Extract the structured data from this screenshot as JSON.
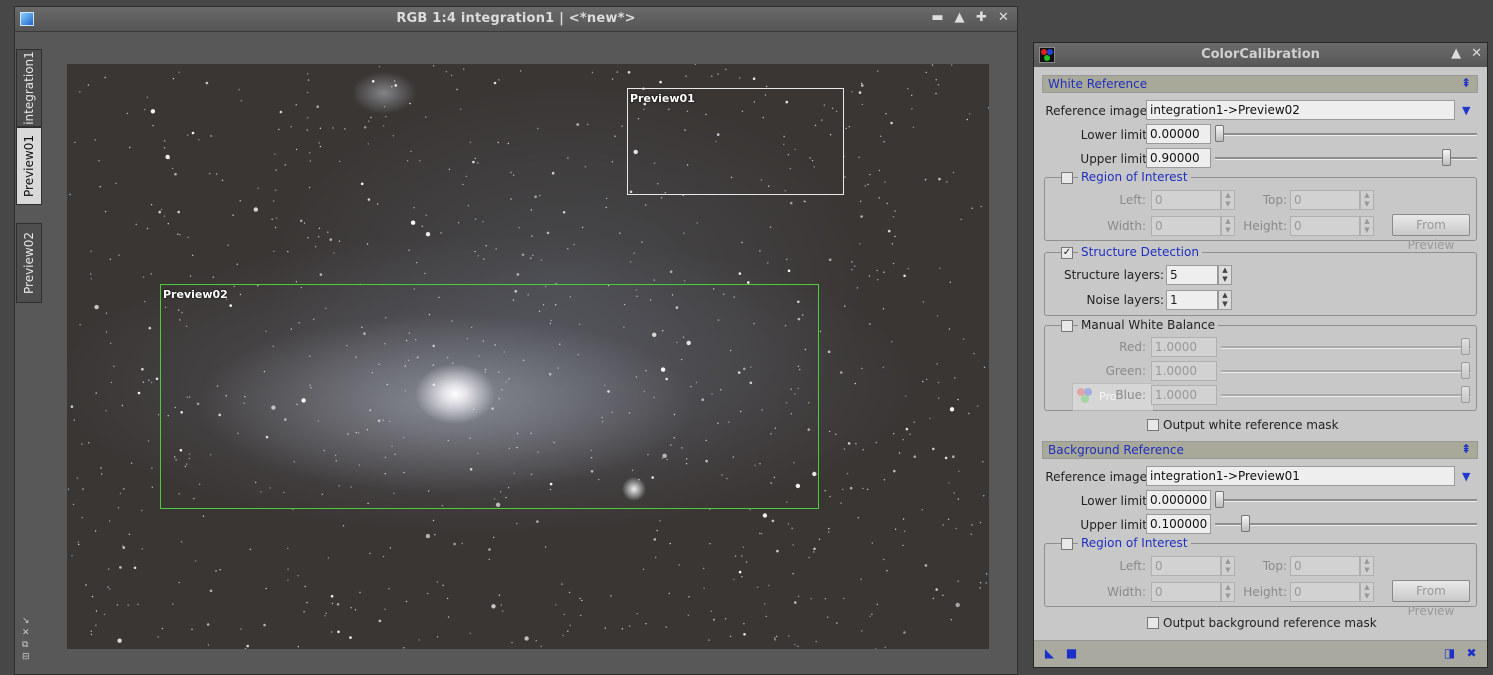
{
  "image_window": {
    "title": "RGB 1:4 integration1 | <*new*>",
    "controls": [
      "▬",
      "▲",
      "✚",
      "✕"
    ],
    "tabs": [
      "integration1",
      "Preview01",
      "Preview02"
    ],
    "active_tab": "Preview01",
    "previews": [
      {
        "label": "Preview01",
        "color": "#e8e8e8"
      },
      {
        "label": "Preview02",
        "color": "#4ecb3c"
      }
    ],
    "side_icons": [
      "↘",
      "✕",
      "⧉",
      "⊟"
    ]
  },
  "dialog": {
    "title": "ColorCalibration",
    "controls": [
      "▲",
      "✕"
    ],
    "white_reference": {
      "header": "White Reference",
      "reference_image_label": "Reference image:",
      "reference_image_value": "integration1->Preview02",
      "lower_limit_label": "Lower limit:",
      "lower_limit_value": "0.00000",
      "lower_limit_fraction": 0.0,
      "upper_limit_label": "Upper limit:",
      "upper_limit_value": "0.90000",
      "upper_limit_fraction": 0.9,
      "roi": {
        "title": "Region of Interest",
        "checked": false,
        "left_label": "Left:",
        "left_value": "0",
        "top_label": "Top:",
        "top_value": "0",
        "width_label": "Width:",
        "width_value": "0",
        "height_label": "Height:",
        "height_value": "0",
        "from_preview": "From Preview"
      },
      "structure": {
        "title": "Structure Detection",
        "checked": true,
        "layers_label": "Structure layers:",
        "layers_value": "5",
        "noise_label": "Noise layers:",
        "noise_value": "1"
      },
      "manual": {
        "title": "Manual White Balance",
        "checked": false,
        "red_label": "Red:",
        "red_value": "1.0000",
        "green_label": "Green:",
        "green_value": "1.0000",
        "blue_label": "Blue:",
        "blue_value": "1.0000",
        "ghost_text": "Pro"
      },
      "output_mask_label": "Output white reference mask"
    },
    "background_reference": {
      "header": "Background Reference",
      "reference_image_label": "Reference image:",
      "reference_image_value": "integration1->Preview01",
      "lower_limit_label": "Lower limit:",
      "lower_limit_value": "0.000000",
      "lower_limit_fraction": 0.0,
      "upper_limit_label": "Upper limit:",
      "upper_limit_value": "0.100000",
      "upper_limit_fraction": 0.1,
      "roi": {
        "title": "Region of Interest",
        "checked": false,
        "left_label": "Left:",
        "left_value": "0",
        "top_label": "Top:",
        "top_value": "0",
        "width_label": "Width:",
        "width_value": "0",
        "height_label": "Height:",
        "height_value": "0",
        "from_preview": "From Preview"
      },
      "output_mask_label": "Output background reference mask"
    },
    "bottom_icons": [
      "◣",
      "■",
      "◨",
      "✖"
    ],
    "colors": {
      "accent": "#1f2fbf",
      "section_bg": "#a9a99a",
      "panel_bg": "#c8c8c8"
    }
  }
}
